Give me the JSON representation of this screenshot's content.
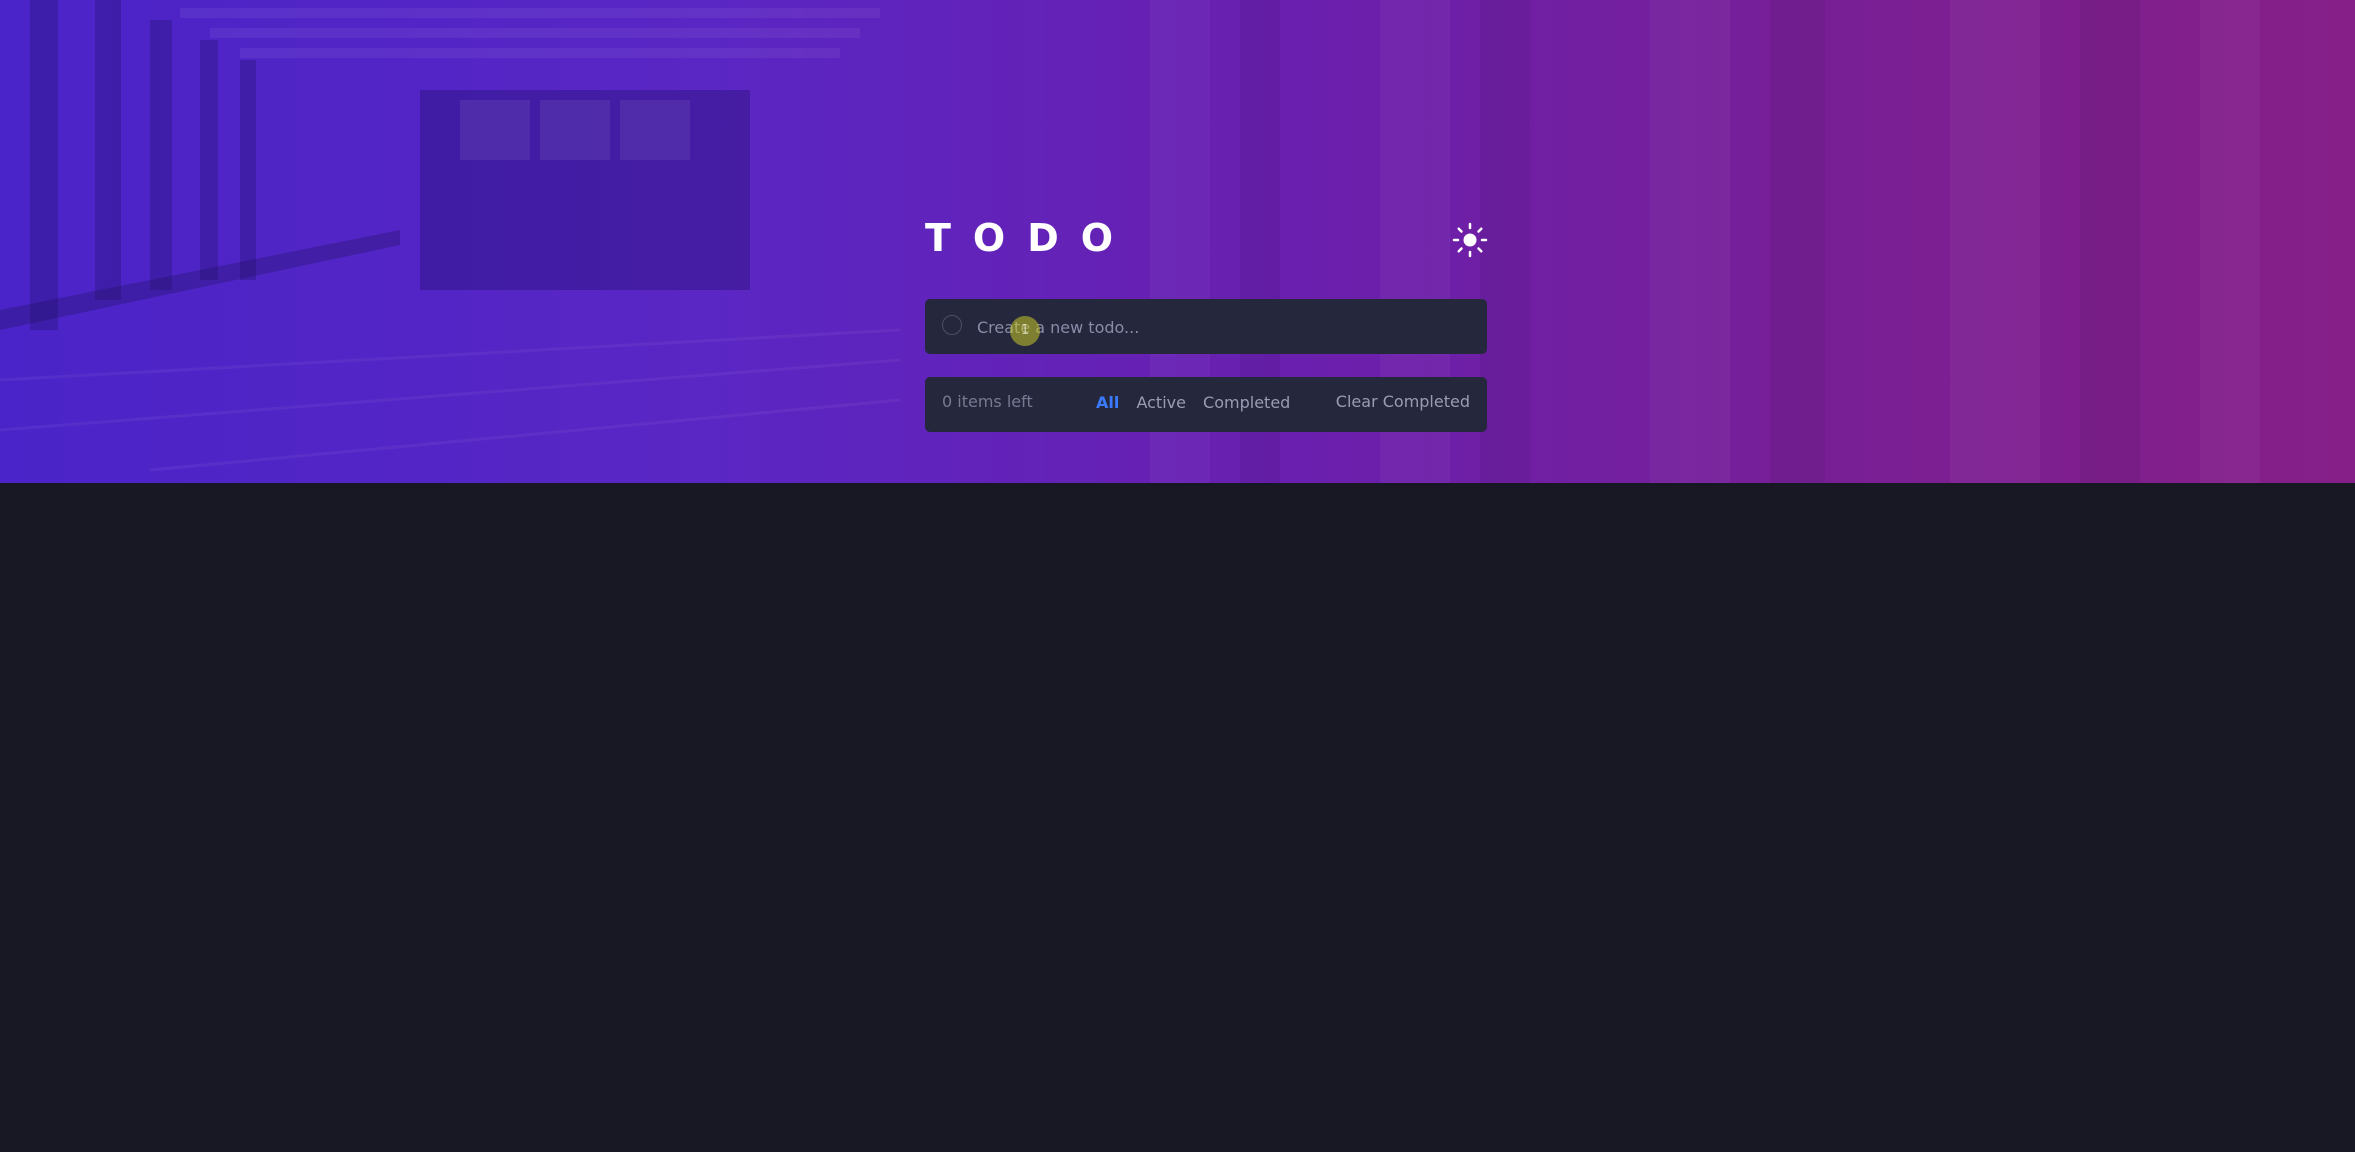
{
  "app": {
    "title": "TODO",
    "theme_toggle_icon": "sun-icon"
  },
  "new_todo": {
    "placeholder": "Create a new todo...",
    "value": "",
    "cursor_label": "1"
  },
  "footer": {
    "items_left": "0 items left",
    "filters": [
      {
        "label": "All",
        "active": true
      },
      {
        "label": "Active",
        "active": false
      },
      {
        "label": "Completed",
        "active": false
      }
    ],
    "clear_label": "Clear Completed"
  },
  "colors": {
    "page_background": "#181824",
    "card_background": "#25273c",
    "active_filter": "#3a7bfd",
    "gradient_start": "#4a24c8",
    "gradient_end": "#861f88"
  }
}
